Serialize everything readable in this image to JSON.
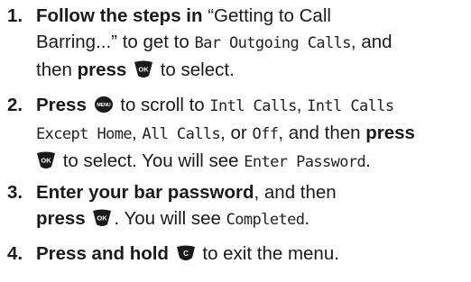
{
  "steps": [
    {
      "number": "1.",
      "lines": [
        {
          "bold": "Follow the steps in",
          "text1": " “Getting to Call"
        },
        {
          "text1": "Barring...” to get to ",
          "lcd": "Bar Outgoing Calls",
          "text2": ", and"
        },
        {
          "text1": "then ",
          "bold": "press",
          "text2": " to select."
        }
      ]
    },
    {
      "number": "2.",
      "lines": [
        {
          "bold": "Press",
          "text1": " to scroll to ",
          "lcd1": "Intl Calls",
          "text2": ", ",
          "lcd2": "Intl Calls"
        },
        {
          "lcd1": "Except Home",
          "text1": ", ",
          "lcd2": "All Calls",
          "text2": ", or ",
          "lcd3": "Off",
          "text3": ", and then ",
          "bold": "press"
        },
        {
          "text1": " to select. You will see ",
          "lcd": "Enter Password",
          "text2": "."
        }
      ]
    },
    {
      "number": "3.",
      "lines": [
        {
          "bold": "Enter your bar password",
          "text1": ", and then"
        },
        {
          "bold": "press",
          "text1": ". You will see ",
          "lcd": "Completed",
          "text2": "."
        }
      ]
    },
    {
      "number": "4.",
      "lines": [
        {
          "bold": "Press and hold",
          "text1": " to exit the menu."
        }
      ]
    }
  ],
  "icons": {
    "ok": "ok-key-icon",
    "menu": "menu-key-icon",
    "clear": "c-key-icon"
  },
  "icon_labels": {
    "ok": "OK",
    "menu": "MENU",
    "clear": "C"
  },
  "colors": {
    "text": "#1a1a1a",
    "key_fill": "#1a1a1a",
    "key_label": "#ffffff"
  }
}
